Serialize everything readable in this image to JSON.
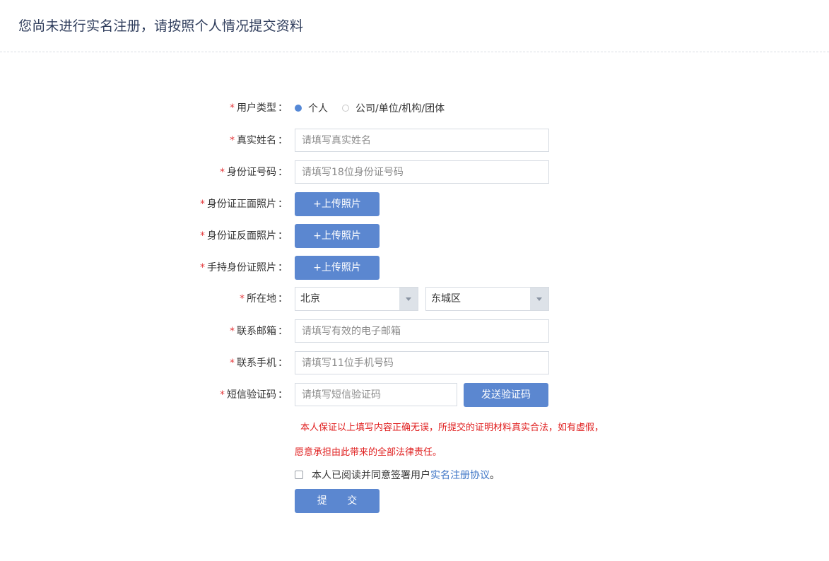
{
  "page": {
    "title": "您尚未进行实名注册，请按照个人情况提交资料"
  },
  "form": {
    "required_mark": "*",
    "colon": "：",
    "user_type": {
      "label": "用户类型",
      "options": [
        "个人",
        "公司/单位/机构/团体"
      ],
      "selected": "个人"
    },
    "real_name": {
      "label": "真实姓名",
      "placeholder": "请填写真实姓名"
    },
    "id_number": {
      "label": "身份证号码",
      "placeholder": "请填写18位身份证号码"
    },
    "id_front": {
      "label": "身份证正面照片",
      "button": "+上传照片"
    },
    "id_back": {
      "label": "身份证反面照片",
      "button": "+上传照片"
    },
    "id_hand": {
      "label": "手持身份证照片",
      "button": "+上传照片"
    },
    "location": {
      "label": "所在地",
      "province": "北京",
      "district": "东城区"
    },
    "email": {
      "label": "联系邮箱",
      "placeholder": "请填写有效的电子邮箱"
    },
    "phone": {
      "label": "联系手机",
      "placeholder": "请填写11位手机号码"
    },
    "sms_code": {
      "label": "短信验证码",
      "placeholder": "请填写短信验证码",
      "button": "发送验证码"
    },
    "warning_line1": "本人保证以上填写内容正确无误，所提交的证明材料真实合法，如有虚假，",
    "warning_line2": "愿意承担由此带来的全部法律责任。",
    "agreement": {
      "checked": false,
      "text": "本人已阅读并同意签署用户",
      "link": "实名注册协议",
      "suffix": "。"
    },
    "submit": "提 交"
  },
  "colors": {
    "primary": "#5b87d0",
    "warning": "#e02020",
    "link": "#3b73c5",
    "title": "#2f3d5c"
  }
}
